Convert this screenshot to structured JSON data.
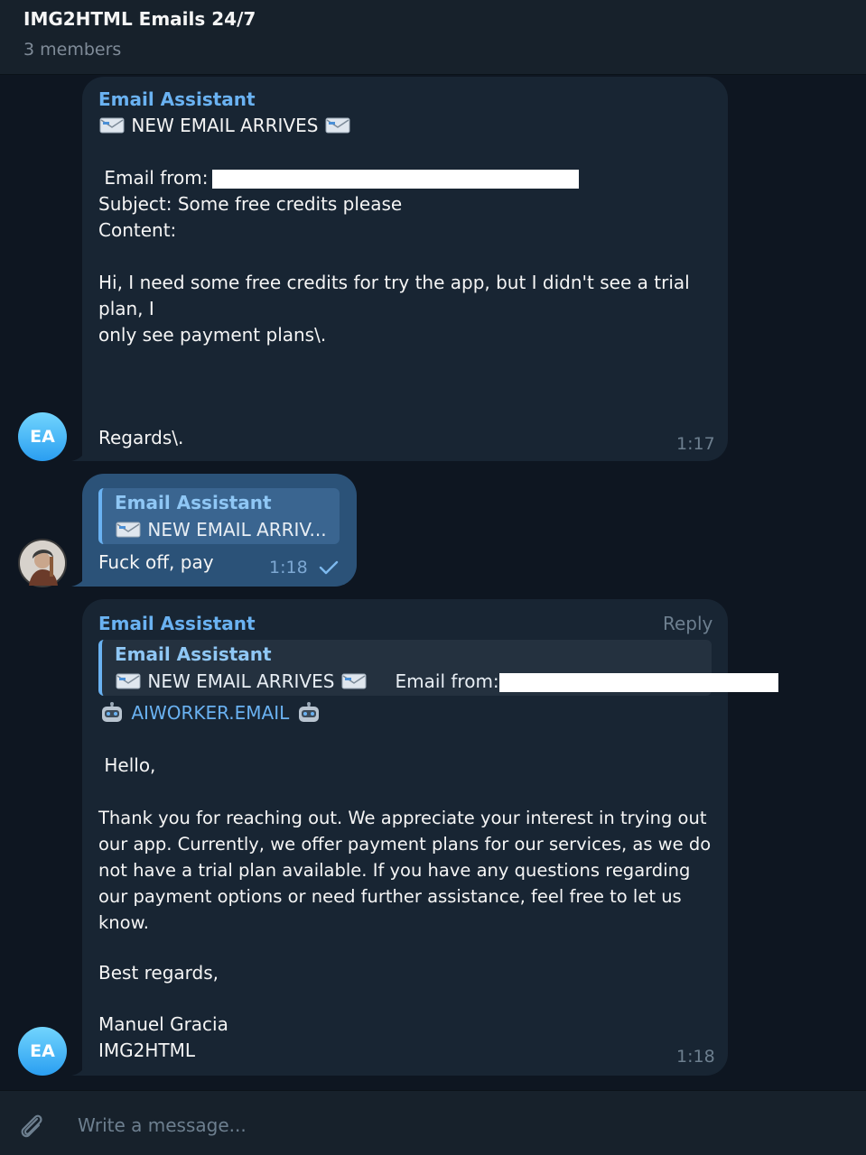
{
  "header": {
    "title": "IMG2HTML Emails 24/7",
    "subtitle": "3 members"
  },
  "messages": [
    {
      "sender": "Email Assistant",
      "avatar_initials": "EA",
      "heading": "NEW EMAIL ARRIVES",
      "email_from_label": " Email from: ",
      "subject": "Subject: Some free credits please",
      "content_label": "Content:",
      "body": "Hi, I need some free credits for try the app, but I didn't see a trial\nplan, I\nonly see payment plans\\.",
      "closing": "Regards\\.",
      "time": "1:17"
    },
    {
      "quote_sender": "Email Assistant",
      "quote_text": "NEW EMAIL ARRIV...",
      "text": "Fuck off, pay",
      "time": "1:18"
    },
    {
      "sender": "Email Assistant",
      "avatar_initials": "EA",
      "reply_label": "Reply",
      "quote_sender": "Email Assistant",
      "quote_text_1": "NEW EMAIL ARRIVES",
      "quote_text_2": "Email from: ",
      "brand": "AIWORKER.EMAIL",
      "greeting": " Hello,",
      "body": "Thank you for reaching out. We appreciate your interest in trying out\nour app. Currently, we offer payment plans for our services, as we do\nnot have a trial plan available. If you have any questions regarding\nour payment options or need further assistance, feel free to let us\nknow.",
      "signoff": "Best regards,",
      "signature_name": "Manuel Gracia",
      "signature_company": "IMG2HTML",
      "time": "1:18"
    }
  ],
  "composer": {
    "placeholder": "Write a message..."
  },
  "colors": {
    "background": "#0e1621",
    "incoming_bubble": "#182533",
    "outgoing_bubble": "#2b5278",
    "accent": "#6ab2f2"
  }
}
